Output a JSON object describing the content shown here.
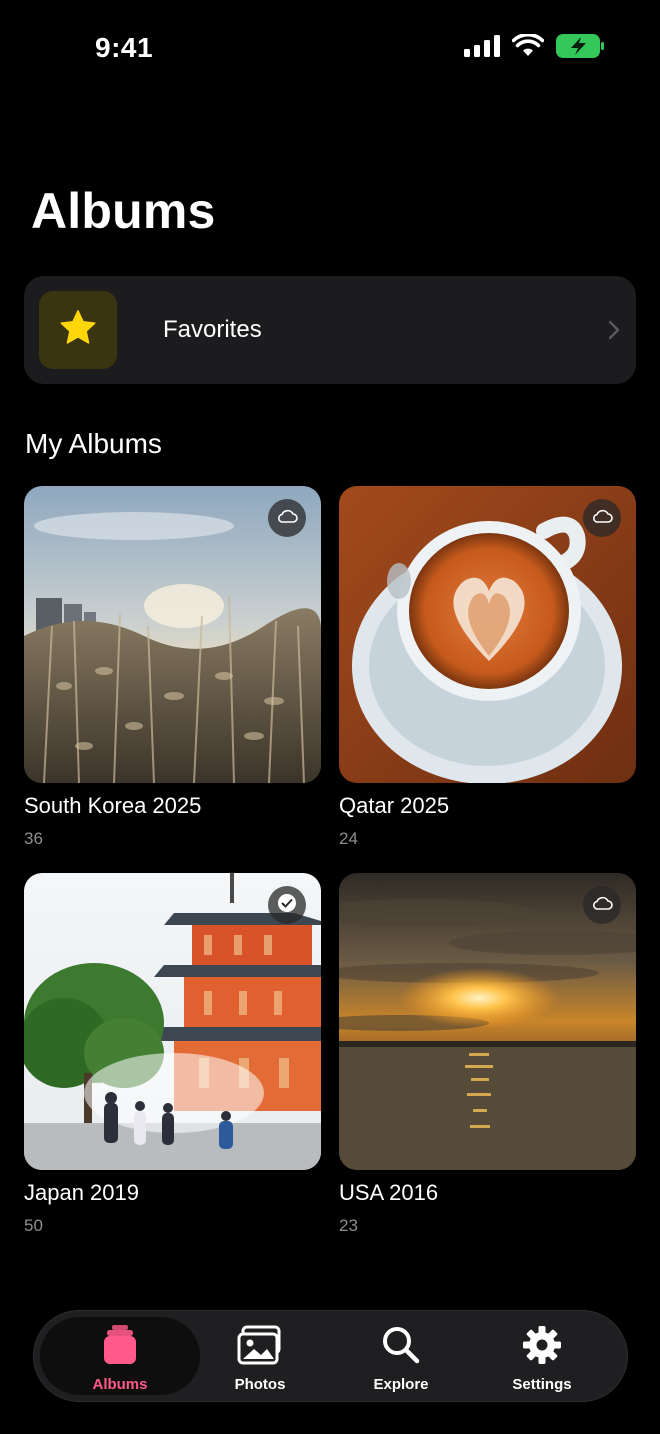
{
  "status_bar": {
    "time": "9:41"
  },
  "header": {
    "title": "Albums"
  },
  "favorites": {
    "label": "Favorites",
    "icon": "star-icon",
    "accent": "#ffd60a"
  },
  "my_albums": {
    "title": "My Albums",
    "albums": [
      {
        "name": "South Korea 2025",
        "count": "36",
        "badge": "cloud-icon"
      },
      {
        "name": "Qatar 2025",
        "count": "24",
        "badge": "cloud-icon"
      },
      {
        "name": "Japan 2019",
        "count": "50",
        "badge": "checkmark-icon"
      },
      {
        "name": "USA 2016",
        "count": "23",
        "badge": "cloud-icon"
      }
    ]
  },
  "tab_bar": {
    "active_color": "#ff5a8a",
    "tabs": [
      {
        "label": "Albums",
        "icon": "albums-icon"
      },
      {
        "label": "Photos",
        "icon": "photos-icon"
      },
      {
        "label": "Explore",
        "icon": "search-icon"
      },
      {
        "label": "Settings",
        "icon": "gear-icon"
      }
    ]
  }
}
